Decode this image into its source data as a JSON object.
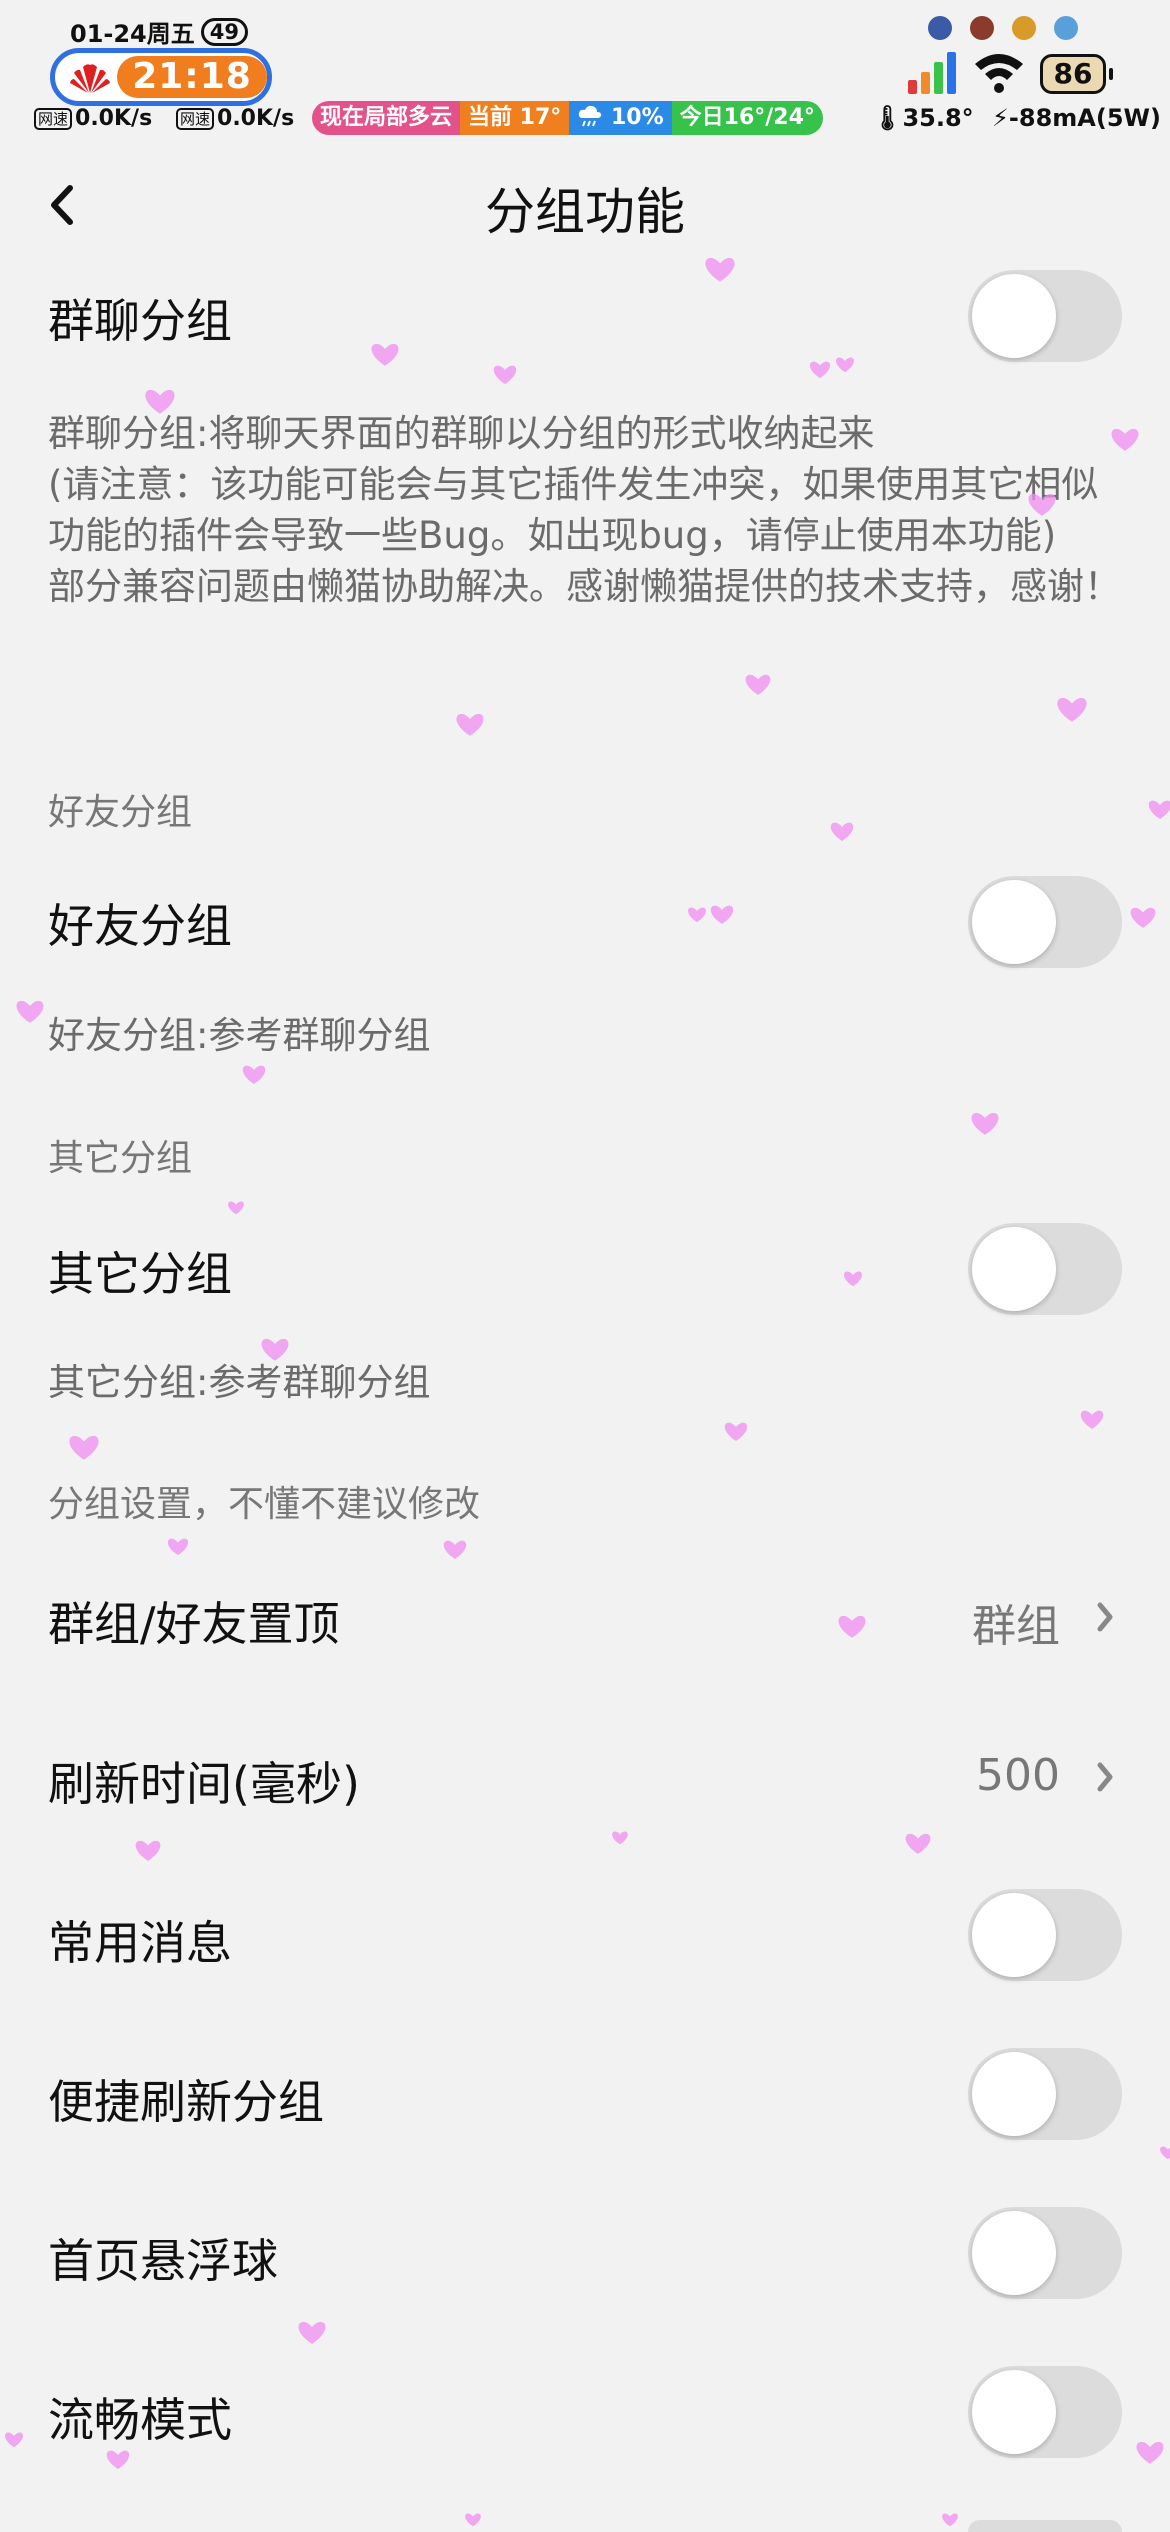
{
  "status_bar": {
    "date": "01-24周五",
    "notification_count": "49",
    "time": "21:18",
    "net_label_1": "网速",
    "net_speed_1": "0.0K/s",
    "net_label_2": "网速",
    "net_speed_2": "0.0K/s",
    "weather_now": "现在局部多云",
    "weather_current": "当前 17°",
    "weather_rain": "10%",
    "weather_today": "今日16°/24°",
    "cpu_temp": "35.8°",
    "current": "-88mA(5W)",
    "battery": "86"
  },
  "nav": {
    "title": "分组功能",
    "back_icon": "chevron-left-icon"
  },
  "settings": {
    "group_chat_label": "群聊分组",
    "group_chat_desc_1": "群聊分组:将聊天界面的群聊以分组的形式收纳起来",
    "group_chat_desc_2": "(请注意：该功能可能会与其它插件发生冲突，如果使用其它相似功能的插件会导致一些Bug。如出现bug，请停止使用本功能)",
    "group_chat_desc_3": "部分兼容问题由懒猫协助解决。感谢懒猫提供的技术支持，感谢！",
    "friend_section": "好友分组",
    "friend_label": "好友分组",
    "friend_desc": "好友分组:参考群聊分组",
    "other_section": "其它分组",
    "other_label": "其它分组",
    "other_desc": "其它分组:参考群聊分组",
    "settings_section": "分组设置，不懂不建议修改",
    "pin_label": "群组/好友置顶",
    "pin_value": "群组",
    "refresh_label": "刷新时间(毫秒)",
    "refresh_value": "500",
    "common_msg_label": "常用消息",
    "quick_refresh_label": "便捷刷新分组",
    "float_ball_label": "首页悬浮球",
    "smooth_label": "流畅模式"
  },
  "toggles": {
    "group_chat": false,
    "friend": false,
    "other": false,
    "common_msg": false,
    "quick_refresh": false,
    "float_ball": false,
    "smooth": false
  },
  "colors": {
    "background": "#f2f2f2",
    "toggle_off": "#dcdcdc",
    "heart": "#f08cf0",
    "clock_orange": "#f07d1e",
    "clock_border": "#2f6fe0"
  }
}
